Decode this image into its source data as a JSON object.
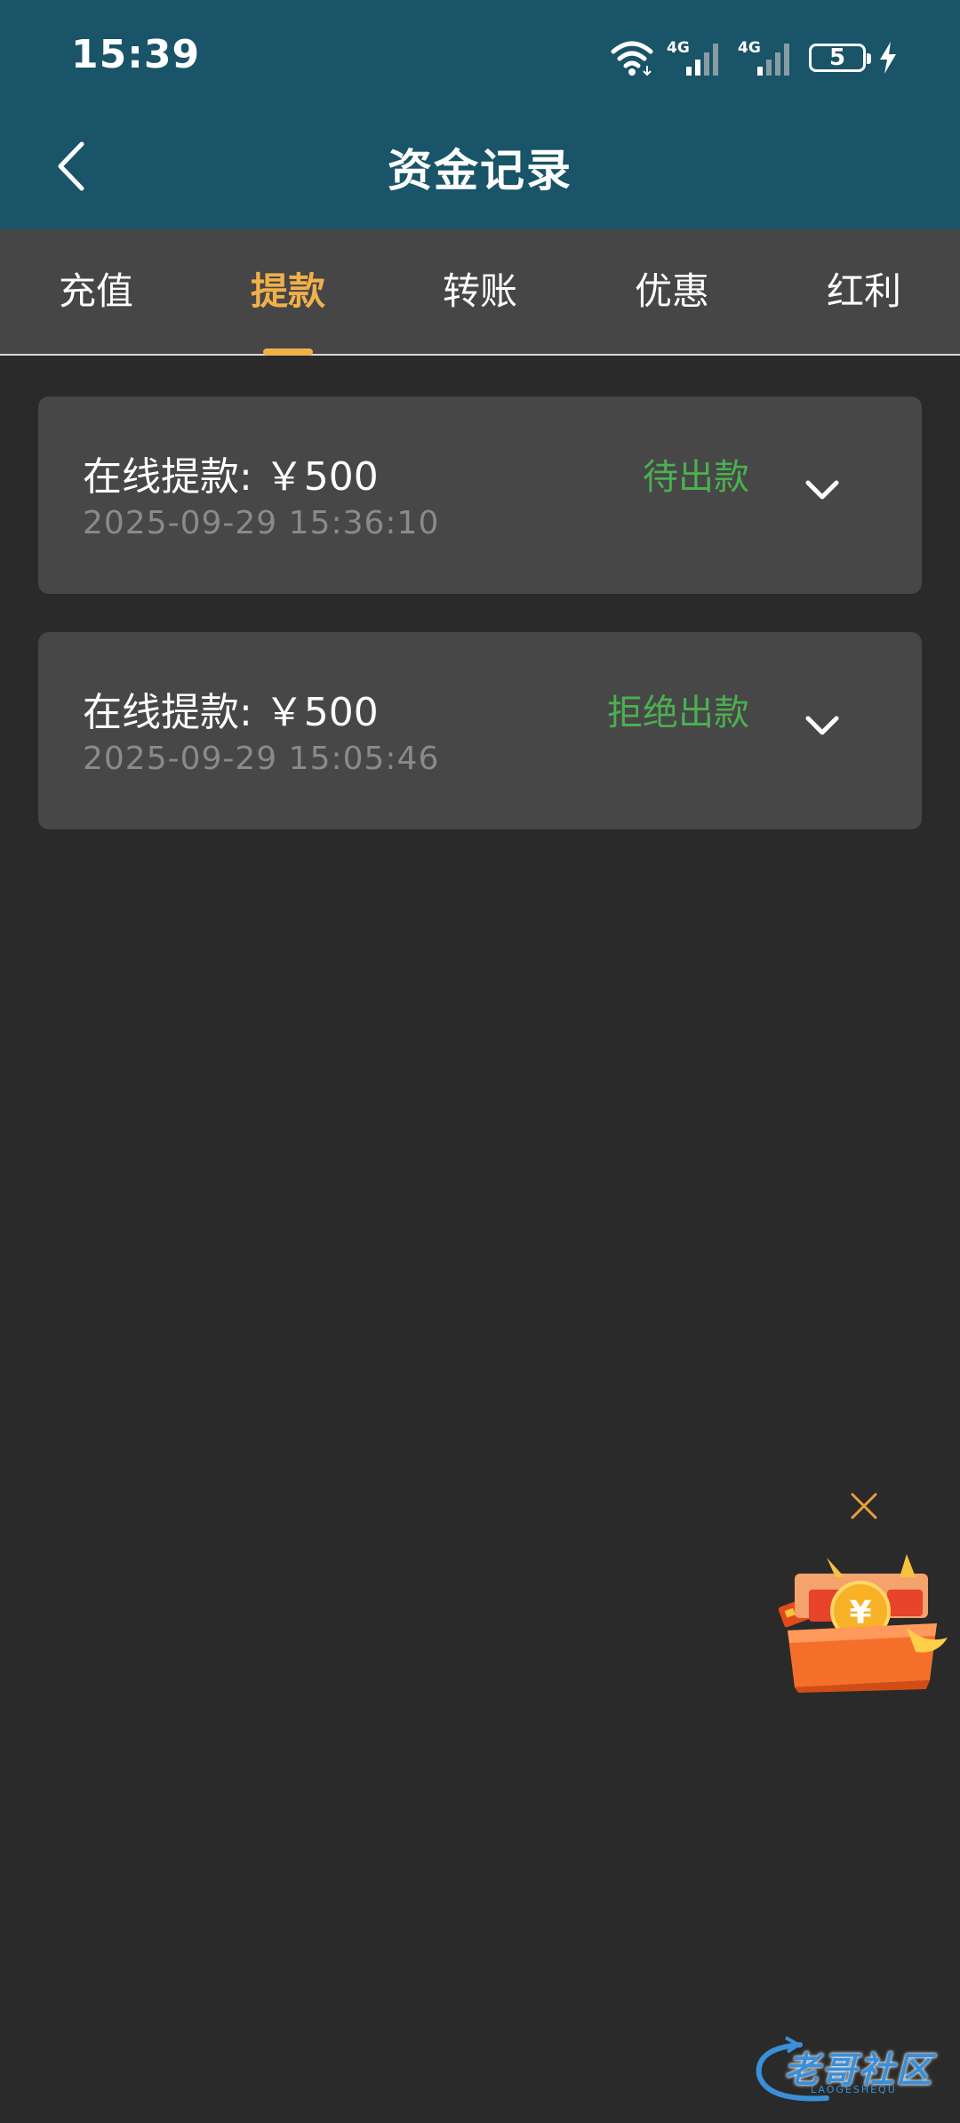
{
  "status_bar": {
    "time": "15:39",
    "network_1": "4G",
    "network_2": "4G",
    "battery": "5"
  },
  "header": {
    "title": "资金记录",
    "back_icon": "chevron-left-icon"
  },
  "tabs": [
    {
      "label": "充值",
      "active": false
    },
    {
      "label": "提款",
      "active": true
    },
    {
      "label": "转账",
      "active": false
    },
    {
      "label": "优惠",
      "active": false
    },
    {
      "label": "红利",
      "active": false
    }
  ],
  "records": [
    {
      "title": "在线提款: ￥500",
      "time": "2025-09-29 15:36:10",
      "status": "待出款"
    },
    {
      "title": "在线提款: ￥500",
      "time": "2025-09-29 15:05:46",
      "status": "拒绝出款"
    }
  ],
  "floating_promo": {
    "icon": "gift-box-icon",
    "close_icon": "close-icon"
  },
  "watermark": {
    "text": "老哥社区",
    "subtext": "LAOGESHEQU"
  },
  "colors": {
    "header_bg": "#195468",
    "tab_bg": "#464646",
    "active_tab": "#f0b04a",
    "status_green": "#4caf50",
    "page_bg": "#2a2a2a",
    "card_bg": "#474747"
  }
}
